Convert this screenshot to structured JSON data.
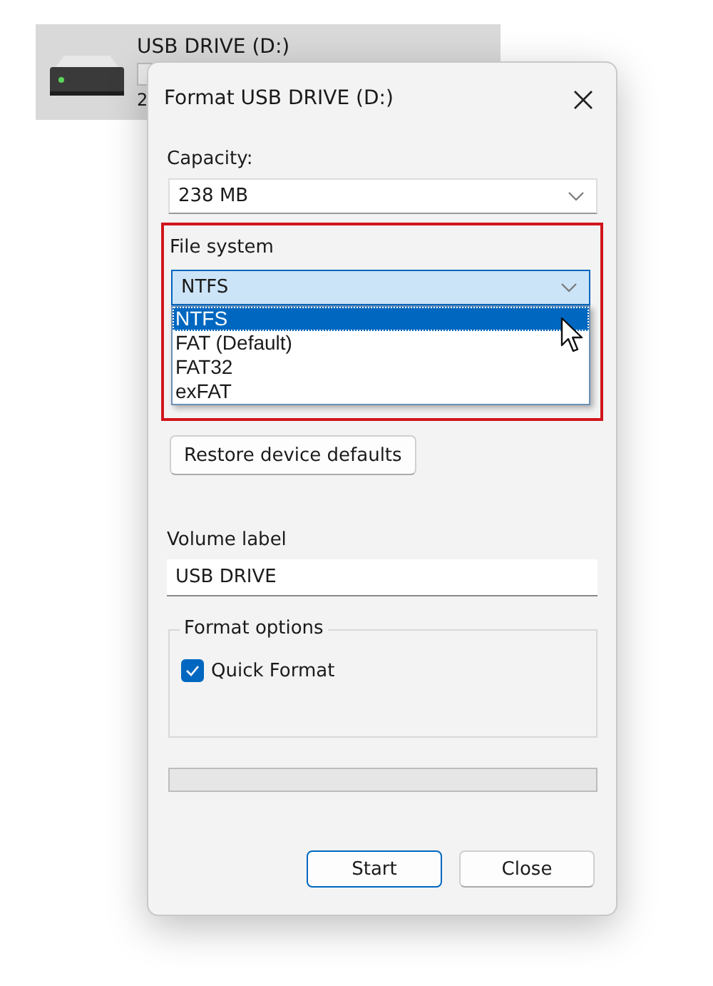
{
  "drive_tile": {
    "name": "USB DRIVE (D:)",
    "detail_text": "2",
    "selected": true
  },
  "dialog": {
    "title": "Format USB DRIVE (D:)",
    "capacity": {
      "label": "Capacity:",
      "value": "238 MB"
    },
    "file_system": {
      "label": "File system",
      "value": "NTFS",
      "expanded": true,
      "highlighted": true,
      "options": [
        {
          "label": "NTFS",
          "selected": true
        },
        {
          "label": "FAT (Default)",
          "selected": false
        },
        {
          "label": "FAT32",
          "selected": false
        },
        {
          "label": "exFAT",
          "selected": false
        }
      ]
    },
    "restore_button": {
      "label": "Restore device defaults"
    },
    "volume_label": {
      "label": "Volume label",
      "value": "USB DRIVE"
    },
    "format_options": {
      "legend": "Format options",
      "quick_format": {
        "label": "Quick Format",
        "checked": true
      }
    },
    "progress": {
      "level": 0
    },
    "buttons": [
      {
        "label": "Start",
        "default": true
      },
      {
        "label": "Close",
        "default": false
      }
    ]
  }
}
